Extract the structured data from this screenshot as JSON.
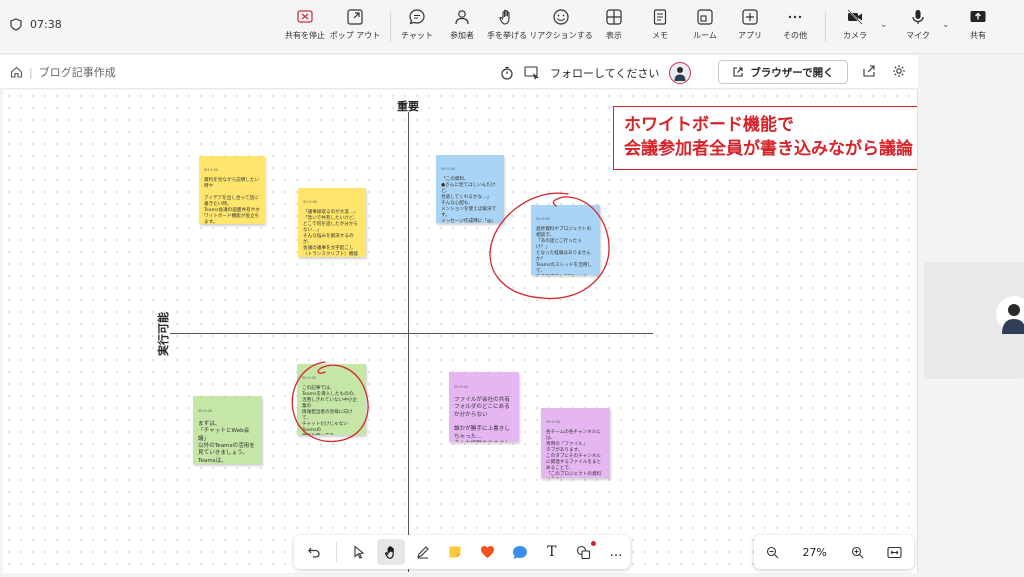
{
  "meeting": {
    "timer": "07:38",
    "buttons": {
      "stop_share": "共有を停止",
      "popout": "ポップ アウト",
      "chat": "チャット",
      "participants": "参加者",
      "raise_hand": "手を挙げる",
      "reactions": "リアクションする",
      "view": "表示",
      "notes": "メモ",
      "rooms": "ルーム",
      "apps": "アプリ",
      "more": "その他",
      "camera": "カメラ",
      "mic": "マイク",
      "share": "共有"
    }
  },
  "whiteboard": {
    "title": "ブログ記事作成",
    "follow_text": "フォローしてください",
    "open_browser": "ブラウザーで開く",
    "axis_top": "重要",
    "axis_left": "実行可能",
    "callout": [
      "ホワイトボード機能で",
      "会議参加者全員が書き込みながら議論"
    ],
    "notes": [
      {
        "id": "note-yellow-1",
        "header": "SH 0:00",
        "text": "資料を見ながら説明したい時や\n\nアイデアを出し合って話に書きたい時。\nTeams会議の画面共有やホワイトボード機能が役立ちます。\n作業者全員で同じ資料を見たり、自由に書き込みながら議論を深められます。"
      },
      {
        "id": "note-yellow-2",
        "header": "SH 0:00",
        "text": "「議事録取るのが大変…」\n「急いで共有したいけど、どこで何を話したか分からない…」\nそんな悩みを解決するのが、\n会議の議事を文字起こし（トランスクリプト）機能です。\n会議の内容を自動で記録するため、議事録作成の負担が減り、\n欠席者への情報共有もスムーズになります。"
      },
      {
        "id": "note-blue-1",
        "header": "SH 0:00",
        "text": "「この資料、\n●さんに見てほしいんだけど、\n見逃してくれるかな…」\nそんな心配も、\nメンションを使えば解決です。\nメッセージ作成時に「@」\nを入力して相手の名前を選ぶと、その人に通知が届き、\n見落としを防げます。"
      },
      {
        "id": "note-blue-2",
        "header": "SH 0:00",
        "text": "進捗資料やプロジェクトの相談で、\n「あの話どこ行ったっけ？」\nとなった経験はありませんか？\nTeamsのスレッドを活用して、\n件名を明記して同じトピックでのメッセージに返信する「返信」が理想です。\nこれにより、\n話題ごとの整理がされ後から見返すのも楽になり、\n後から見返すときも情報共有がスムーズになります。"
      },
      {
        "id": "note-green-1",
        "header": "SH 0:00",
        "text": "この記事では、\nTeamsを導入したものの、\n活用しきれていない中小企業の\n情報担当者の皆様に向けて、\nチャットだけじゃないTeamsの\n便利な使い方を、\nわかりやすい言葉と具体的な\nイメージでお伝えします。"
      },
      {
        "id": "note-green-2",
        "header": "SH 0:00",
        "text": "まずは、\n「チャットとWeb会議」\n以外のTeamsの活用を見ていきましょう。Teamsは、\nあなたの会社の日々の業務をスムーズにするための、\nたくさんの機能を秘めています。"
      },
      {
        "id": "note-purple-1",
        "header": "SH 0:00",
        "text": "ファイルが会社の共有フォルダのどこにあるか分からない\n\n誰かが勝手に上書きしちゃった…\nそんな経験ありませんか？\nTeamsを使えば、\nファイル管理の悩みが大きく軽減します。"
      },
      {
        "id": "note-purple-2",
        "header": "SH 0:00",
        "text": "各チームの各チャンネルには、\n専用の「ファイル」\nタブがあります。\nこのタブにそのチャンネルに関連するファイルをまとめることで、\n「このプロジェクトの資料はここ！」\nと一目で分かるようになります。"
      }
    ]
  },
  "toolbar": {
    "text_tool": "T",
    "more": "…"
  },
  "zoom": {
    "level": "27%"
  },
  "colors": {
    "accent_red": "#d6232a",
    "note_yellow": "#ffe56b",
    "note_blue": "#a9d4f5",
    "note_green": "#c5e6a6",
    "note_purple": "#e6b6f2"
  }
}
